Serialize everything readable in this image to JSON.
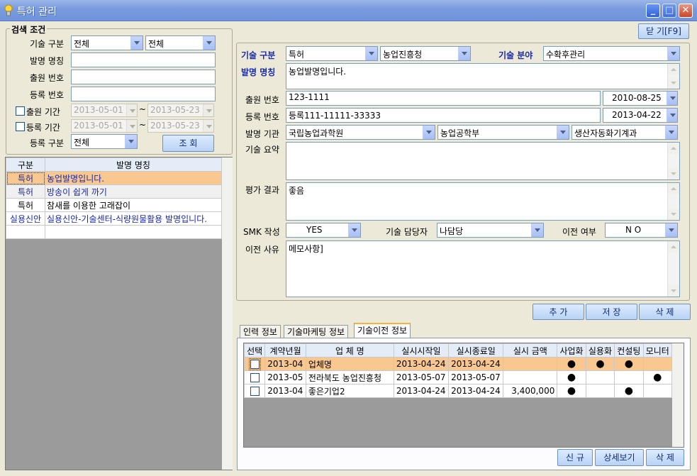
{
  "window": {
    "title": "특허 관리"
  },
  "close_button": "닫 기[F9]",
  "search": {
    "legend": "검색 조건",
    "tech_category_label": "기술 구분",
    "tech_category_value1": "전체",
    "tech_category_value2": "전체",
    "invention_name_label": "발명 명칭",
    "application_no_label": "출원 번호",
    "registration_no_label": "등록 번호",
    "application_period_label": "출원 기간",
    "application_from": "2013-05-01",
    "application_to": "2013-05-23",
    "registration_period_label": "등록 기간",
    "registration_from": "2013-05-01",
    "registration_to": "2013-05-23",
    "tilde": "~",
    "registration_type_label": "등록 구분",
    "registration_type_value": "전체",
    "search_button": "조  회"
  },
  "left_grid": {
    "headers": [
      "구분",
      "발명 명칭"
    ],
    "rows": [
      {
        "type": "특허",
        "name": "농업발명입니다."
      },
      {
        "type": "특허",
        "name": "방송이 쉽게 까기"
      },
      {
        "type": "특허",
        "name": "참새를 이용한 고래잡이"
      },
      {
        "type": "실용신안",
        "name": "실용신안-기술센터-식량원물활용 발명입니다."
      }
    ]
  },
  "detail": {
    "tech_category_label": "기술 구분",
    "tech_category_value": "특허",
    "agency_value": "농업진흥청",
    "tech_field_label": "기술 분야",
    "tech_field_value": "수확후관리",
    "invention_name_label": "발명 명칭",
    "invention_name_value": "농업발명입니다.",
    "application_no_label": "출원 번호",
    "application_no_value": "123-1111",
    "application_date": "2010-08-25",
    "registration_no_label": "등록 번호",
    "registration_no_value": "등록111-11111-33333",
    "registration_date": "2013-04-22",
    "org_label": "발명 기관",
    "org_value1": "국립농업과학원",
    "org_value2": "농업공학부",
    "org_value3": "생산자동화기계과",
    "summary_label": "기술 요약",
    "summary_value": "",
    "evaluation_label": "평가 결과",
    "evaluation_value": "좋음",
    "smk_label": "SMK 작성",
    "smk_value": "YES",
    "manager_label": "기술 담당자",
    "manager_value": "나담당",
    "transfer_label": "이전 여부",
    "transfer_value": "N O",
    "transfer_reason_label": "이전 사유",
    "transfer_reason_value": "메모사항]"
  },
  "actions": {
    "add": "추 가",
    "save": "저 장",
    "delete": "삭 제"
  },
  "tabs": [
    {
      "label": "인력 정보"
    },
    {
      "label": "기술마케팅 정보"
    },
    {
      "label": "기술이전 정보"
    }
  ],
  "contract_grid": {
    "headers": [
      "선택",
      "계약년월",
      "업 체 명",
      "실시시작일",
      "실시종료일",
      "실시 금액",
      "사업화",
      "실용화",
      "컨설팅",
      "모니터"
    ],
    "rows": [
      {
        "month": "2013-04",
        "company": "업체명",
        "start": "2013-04-24",
        "end": "2013-04-24",
        "amount": "",
        "biz": "●",
        "prac": "●",
        "consult": "●",
        "monitor": ""
      },
      {
        "month": "2013-05",
        "company": "전라북도 농업진흥청",
        "start": "2013-05-07",
        "end": "2013-05-07",
        "amount": "",
        "biz": "●",
        "prac": "",
        "consult": "",
        "monitor": "●"
      },
      {
        "month": "2013-04",
        "company": "좋은기업2",
        "start": "2013-04-24",
        "end": "2013-04-24",
        "amount": "3,400,000",
        "biz": "●",
        "prac": "",
        "consult": "●",
        "monitor": ""
      }
    ]
  },
  "bottom_actions": {
    "new": "신 규",
    "detail": "상세보기",
    "delete": "삭 제"
  }
}
